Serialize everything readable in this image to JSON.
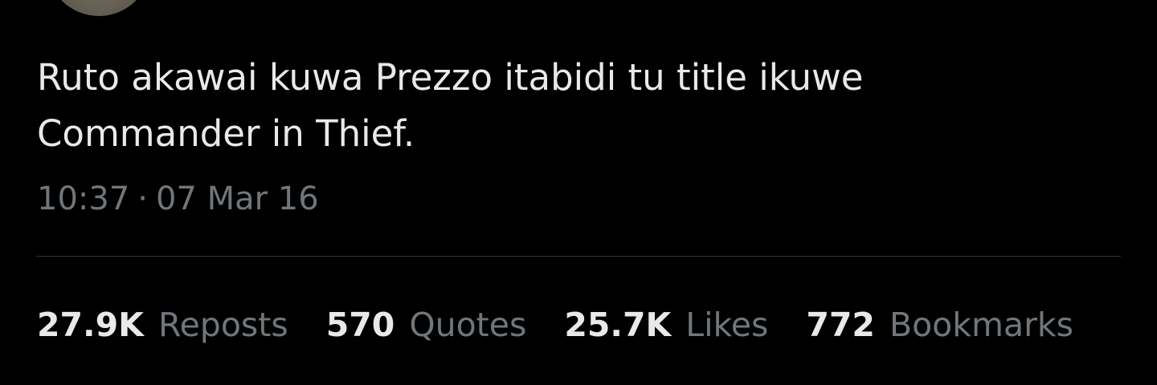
{
  "tweet": {
    "text_line1": "Ruto akawai kuwa Prezzo itabidi tu title ikuwe",
    "text_line2": "Commander in Thief.",
    "time": "10:37",
    "separator": "·",
    "date": "07 Mar 16"
  },
  "stats": [
    {
      "count": "27.9K",
      "label": "Reposts"
    },
    {
      "count": "570",
      "label": "Quotes"
    },
    {
      "count": "25.7K",
      "label": "Likes"
    },
    {
      "count": "772",
      "label": "Bookmarks"
    }
  ],
  "colors": {
    "background": "#000000",
    "primary_text": "#e7e9ea",
    "secondary_text": "#71767b",
    "divider": "#2f3336"
  }
}
